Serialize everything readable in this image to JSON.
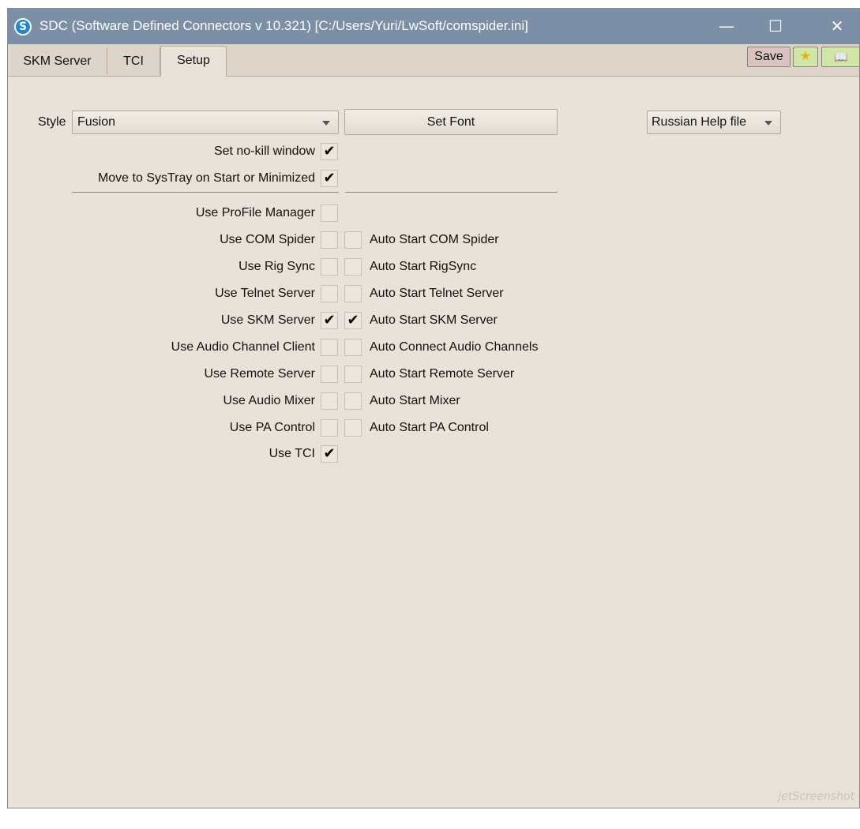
{
  "window": {
    "title": "SDC (Software Defined Connectors v 10.321) [C:/Users/Yuri/LwSoft/comspider.ini]",
    "app_icon": "S",
    "minimize_icon": "—",
    "maximize_icon": "☐",
    "close_icon": "✕"
  },
  "tabs": [
    {
      "label": "SKM Server"
    },
    {
      "label": "TCI"
    },
    {
      "label": "Setup"
    }
  ],
  "toolbar": {
    "save_label": "Save",
    "favorite_icon": "★",
    "help_icon": "📖"
  },
  "setup": {
    "style_label": "Style",
    "style_value": "Fusion",
    "set_font_label": "Set Font",
    "help_file_value": "Russian Help file",
    "no_kill_label": "Set no-kill window",
    "no_kill_checked": true,
    "systray_label": "Move to SysTray on Start or Minimized",
    "systray_checked": true,
    "profile_manager_label": "Use ProFile Manager",
    "profile_manager_checked": false,
    "modules": [
      {
        "use_label": "Use COM Spider",
        "use_checked": false,
        "auto_label": "Auto Start COM Spider",
        "auto_checked": false
      },
      {
        "use_label": "Use Rig Sync",
        "use_checked": false,
        "auto_label": "Auto Start RigSync",
        "auto_checked": false
      },
      {
        "use_label": "Use Telnet Server",
        "use_checked": false,
        "auto_label": "Auto Start Telnet Server",
        "auto_checked": false
      },
      {
        "use_label": "Use SKM Server",
        "use_checked": true,
        "auto_label": "Auto Start SKM Server",
        "auto_checked": true
      },
      {
        "use_label": "Use Audio Channel Client",
        "use_checked": false,
        "auto_label": "Auto Connect Audio Channels",
        "auto_checked": false
      },
      {
        "use_label": "Use Remote Server",
        "use_checked": false,
        "auto_label": "Auto Start Remote Server",
        "auto_checked": false
      },
      {
        "use_label": "Use Audio Mixer",
        "use_checked": false,
        "auto_label": "Auto Start Mixer",
        "auto_checked": false
      },
      {
        "use_label": "Use PA Control",
        "use_checked": false,
        "auto_label": "Auto Start PA Control",
        "auto_checked": false
      }
    ],
    "tci_label": "Use TCI",
    "tci_checked": true
  },
  "check_glyph": "✔",
  "watermark": "jetScreenshot"
}
